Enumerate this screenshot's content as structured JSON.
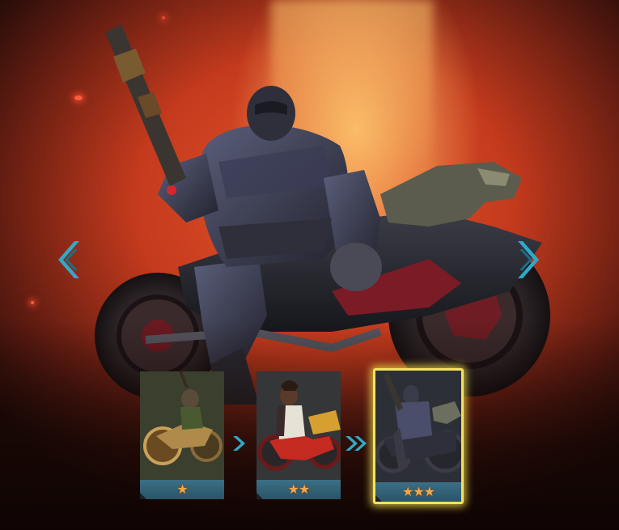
{
  "scene": {
    "accent_color": "#2fa9c7",
    "highlight_color": "#f4e35a",
    "star_color": "#f3a64a"
  },
  "navigation": {
    "prev_icon": "chevron-left-icon",
    "next_icon": "chevron-right-icon"
  },
  "tiers": [
    {
      "stars": "★",
      "rating": 1,
      "selected": false
    },
    {
      "stars": "★★",
      "rating": 2,
      "selected": false
    },
    {
      "stars": "★★★",
      "rating": 3,
      "selected": true
    }
  ],
  "connectors": [
    {
      "icon": "single-chevron-icon"
    },
    {
      "icon": "double-chevron-icon"
    }
  ]
}
